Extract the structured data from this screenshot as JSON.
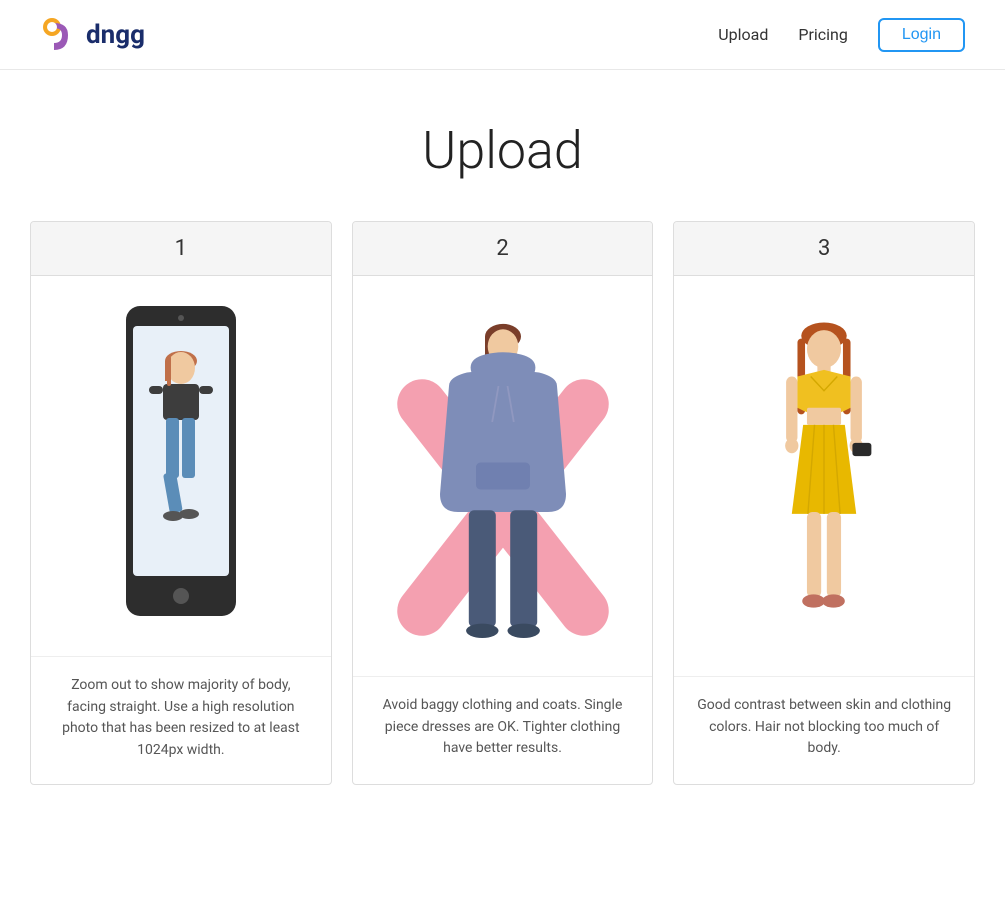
{
  "header": {
    "logo_text": "dngg",
    "nav": {
      "upload_label": "Upload",
      "pricing_label": "Pricing",
      "login_label": "Login"
    }
  },
  "main": {
    "page_title": "Upload",
    "cards": [
      {
        "number": "1",
        "caption": "Zoom out to show majority of body, facing straight. Use a high resolution photo that has been resized to at least 1024px width."
      },
      {
        "number": "2",
        "caption": "Avoid baggy clothing and coats. Single piece dresses are OK. Tighter clothing have better results."
      },
      {
        "number": "3",
        "caption": "Good contrast between skin and clothing colors. Hair not blocking too much of body."
      }
    ]
  }
}
